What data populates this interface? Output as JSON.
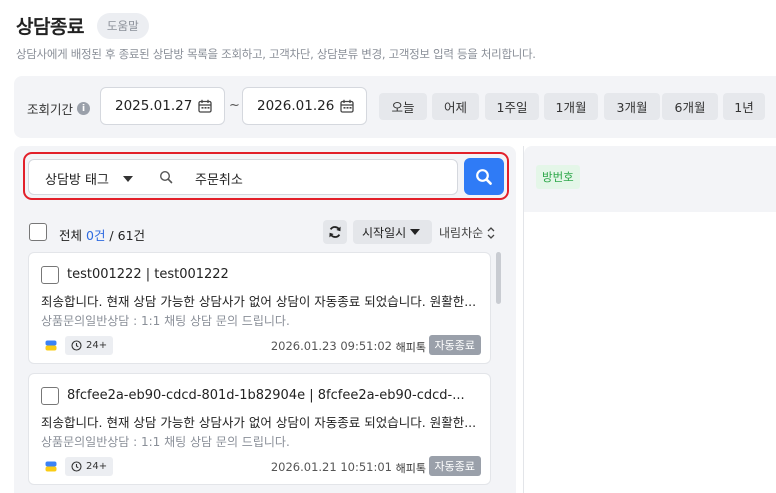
{
  "header": {
    "title": "상담종료",
    "help": "도움말",
    "description": "상담사에게 배정된 후 종료된 상담방 목록을 조회하고, 고객차단, 상담분류 변경, 고객정보 입력 등을 처리합니다."
  },
  "filter": {
    "period_label": "조회기간",
    "info_glyph": "i",
    "start_date": "2025.01.27",
    "end_date": "2026.01.26",
    "separator": "~",
    "quick_ranges": [
      "오늘",
      "어제",
      "1주일",
      "1개월",
      "3개월",
      "6개월",
      "1년"
    ]
  },
  "search": {
    "tag_select": "상담방 태그",
    "query": "주문취소"
  },
  "list": {
    "select_all_label": "전체",
    "selected_count": "0건",
    "total_count": " / 61건",
    "sort_field": "시작일시",
    "sort_order": "내림차순",
    "items": [
      {
        "title": "test001222 | test001222",
        "message": "죄송합니다. 현재 상담 가능한 상담사가 없어 상담이 자동종료 되었습니다. 원활한...",
        "category": "상품문의일반상담 : 1:1 채팅 상담 문의 드립니다.",
        "duration": "24+",
        "date": "2026.01.23 09:51:02",
        "agent": "해피톡",
        "status": "자동종료"
      },
      {
        "title": "8fcfee2a-eb90-cdcd-801d-1b82904e | 8fcfee2a-eb90-cdcd-...",
        "message": "죄송합니다. 현재 상담 가능한 상담사가 없어 상담이 자동종료 되었습니다. 원활한...",
        "category": "상품문의일반상담 : 1:1 채팅 상담 문의 드립니다.",
        "duration": "24+",
        "date": "2026.01.21 10:51:01",
        "agent": "해피톡",
        "status": "자동종료"
      }
    ]
  },
  "detail": {
    "room_label": "방번호"
  },
  "colors": {
    "accent": "#2f7bf6",
    "highlight_border": "#e2202a",
    "status_gray": "#9aa0aa",
    "room_green": "#2ea84a"
  }
}
